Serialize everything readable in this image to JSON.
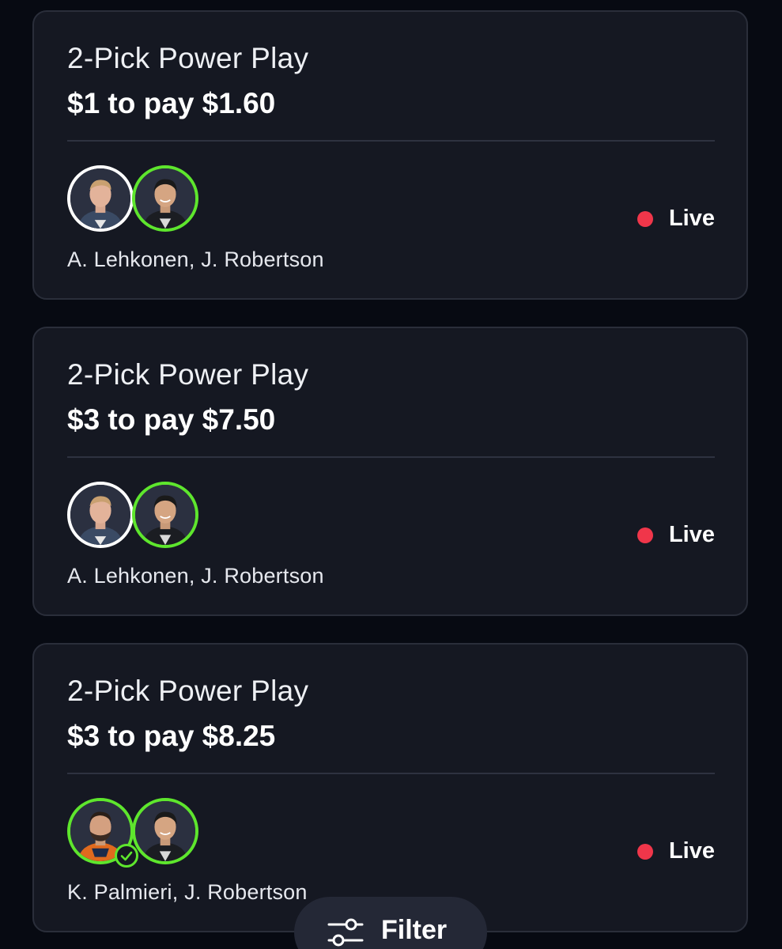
{
  "colors": {
    "background": "#070a12",
    "card": "#151822",
    "live_dot": "#f0364a",
    "win_ring": "#5ee62d",
    "pending_ring": "#ffffff"
  },
  "cards": [
    {
      "title": "2-Pick Power Play",
      "amount": "$1 to pay $1.60",
      "players": "A. Lehkonen, J. Robertson",
      "status": "Live"
    },
    {
      "title": "2-Pick Power Play",
      "amount": "$3 to pay $7.50",
      "players": "A. Lehkonen, J. Robertson",
      "status": "Live"
    },
    {
      "title": "2-Pick Power Play",
      "amount": "$3 to pay $8.25",
      "players": "K. Palmieri, J. Robertson",
      "status": "Live"
    }
  ],
  "filter": {
    "label": "Filter",
    "icon": "sliders-icon"
  }
}
